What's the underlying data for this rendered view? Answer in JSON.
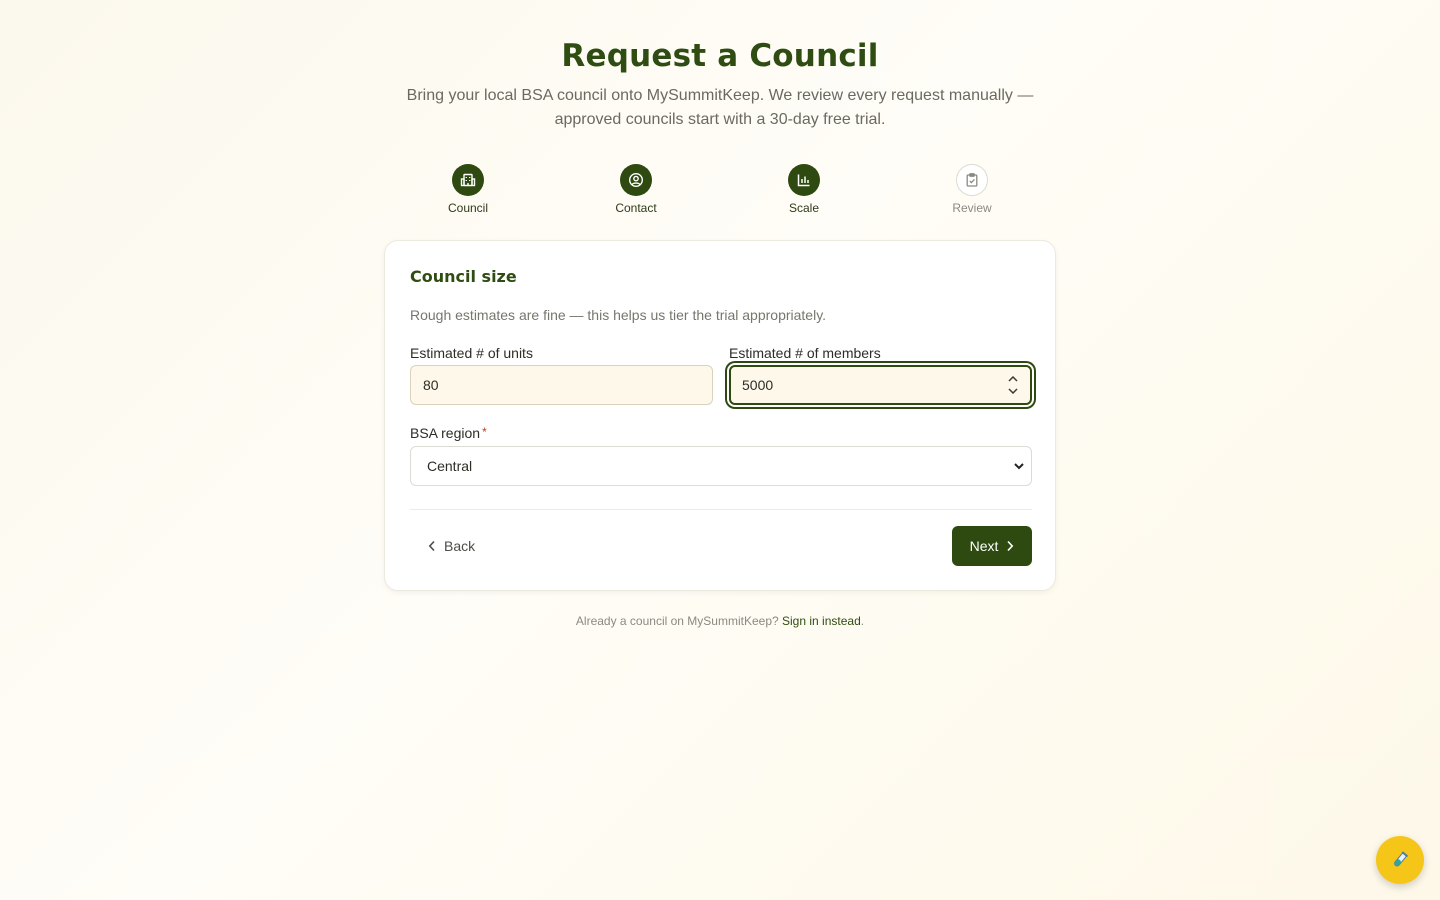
{
  "header": {
    "title": "Request a Council",
    "subtitle": "Bring your local BSA council onto MySummitKeep. We review every request manually — approved councils start with a 30-day free trial."
  },
  "steps": [
    {
      "label": "Council",
      "icon": "building-icon",
      "state": "complete"
    },
    {
      "label": "Contact",
      "icon": "user-circle-icon",
      "state": "complete"
    },
    {
      "label": "Scale",
      "icon": "bar-chart-icon",
      "state": "current"
    },
    {
      "label": "Review",
      "icon": "clipboard-check-icon",
      "state": "upcoming"
    }
  ],
  "form": {
    "title": "Council size",
    "description": "Rough estimates are fine — this helps us tier the trial appropriately.",
    "units_label": "Estimated # of units",
    "units_value": "80",
    "members_label": "Estimated # of members",
    "members_value": "5000",
    "region_label": "BSA region",
    "region_required": "*",
    "region_value": "Central",
    "back_label": "Back",
    "next_label": "Next"
  },
  "footer": {
    "text": "Already a council on MySummitKeep?",
    "link": "Sign in instead",
    "suffix": "."
  },
  "colors": {
    "primary": "#2e4a10",
    "accent": "#f5c518",
    "background": "#fdf9ee"
  },
  "fab": {
    "icon": "test-tube-icon"
  }
}
